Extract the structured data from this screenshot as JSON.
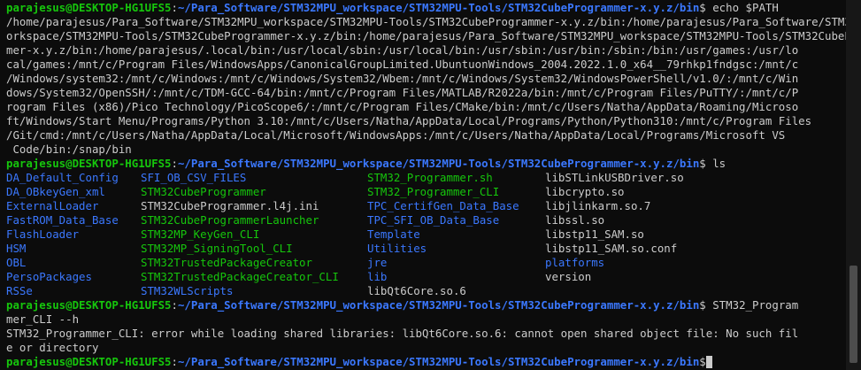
{
  "prompt": {
    "user_host": "parajesus@DESKTOP-HG1UFS5",
    "sep": ":",
    "cwd": "~/Para_Software/STM32MPU_workspace/STM32MPU-Tools/STM32CubeProgrammer-x.y.z/bin",
    "sym": "$"
  },
  "commands": {
    "echo": " echo $PATH",
    "ls": " ls",
    "run_part1": " STM32_Program",
    "run_part2": "mer_CLI --h"
  },
  "path_output": [
    "/home/parajesus/Para_Software/STM32MPU_workspace/STM32MPU-Tools/STM32CubeProgrammer-x.y.z/bin:/home/parajesus/Para_Software/STM32MPU_w",
    "orkspace/STM32MPU-Tools/STM32CubeProgrammer-x.y.z/bin:/home/parajesus/Para_Software/STM32MPU_workspace/STM32MPU-Tools/STM32CubeProgram",
    "mer-x.y.z/bin:/home/parajesus/.local/bin:/usr/local/sbin:/usr/local/bin:/usr/sbin:/usr/bin:/sbin:/bin:/usr/games:/usr/lo",
    "cal/games:/mnt/c/Program Files/WindowsApps/CanonicalGroupLimited.UbuntuonWindows_2004.2022.1.0_x64__79rhkp1fndgsc:/mnt/c",
    "/Windows/system32:/mnt/c/Windows:/mnt/c/Windows/System32/Wbem:/mnt/c/Windows/System32/WindowsPowerShell/v1.0/:/mnt/c/Win",
    "dows/System32/OpenSSH/:/mnt/c/TDM-GCC-64/bin:/mnt/c/Program Files/MATLAB/R2022a/bin:/mnt/c/Program Files/PuTTY/:/mnt/c/P",
    "rogram Files (x86)/Pico Technology/PicoScope6/:/mnt/c/Program Files/CMake/bin:/mnt/c/Users/Natha/AppData/Roaming/Microso",
    "ft/Windows/Start Menu/Programs/Python 3.10:/mnt/c/Users/Natha/AppData/Local/Programs/Python/Python310:/mnt/c/Program Files",
    "/Git/cmd:/mnt/c/Users/Natha/AppData/Local/Microsoft/WindowsApps:/mnt/c/Users/Natha/AppData/Local/Programs/Microsoft VS",
    " Code/bin:/snap/bin"
  ],
  "ls_rows": [
    [
      {
        "t": "DA_Default_Config",
        "k": "dir"
      },
      {
        "t": "SFI_OB_CSV_FILES",
        "k": "dir"
      },
      {
        "t": "STM32_Programmer.sh",
        "k": "exe"
      },
      {
        "t": "libSTLinkUSBDriver.so",
        "k": "plain"
      }
    ],
    [
      {
        "t": "DA_OBkeyGen_xml",
        "k": "dir"
      },
      {
        "t": "STM32CubeProgrammer",
        "k": "exe"
      },
      {
        "t": "STM32_Programmer_CLI",
        "k": "exe"
      },
      {
        "t": "libcrypto.so",
        "k": "plain"
      }
    ],
    [
      {
        "t": "ExternalLoader",
        "k": "dir"
      },
      {
        "t": "STM32CubeProgrammer.l4j.ini",
        "k": "plain"
      },
      {
        "t": "TPC_CertifGen_Data_Base",
        "k": "dir"
      },
      {
        "t": "libjlinkarm.so.7",
        "k": "plain"
      }
    ],
    [
      {
        "t": "FastROM_Data_Base",
        "k": "dir"
      },
      {
        "t": "STM32CubeProgrammerLauncher",
        "k": "exe"
      },
      {
        "t": "TPC_SFI_OB_Data_Base",
        "k": "dir"
      },
      {
        "t": "libssl.so",
        "k": "plain"
      }
    ],
    [
      {
        "t": "FlashLoader",
        "k": "dir"
      },
      {
        "t": "STM32MP_KeyGen_CLI",
        "k": "exe"
      },
      {
        "t": "Template",
        "k": "dir"
      },
      {
        "t": "libstp11_SAM.so",
        "k": "plain"
      }
    ],
    [
      {
        "t": "HSM",
        "k": "dir"
      },
      {
        "t": "STM32MP_SigningTool_CLI",
        "k": "exe"
      },
      {
        "t": "Utilities",
        "k": "dir"
      },
      {
        "t": "libstp11_SAM.so.conf",
        "k": "plain"
      }
    ],
    [
      {
        "t": "OBL",
        "k": "dir"
      },
      {
        "t": "STM32TrustedPackageCreator",
        "k": "exe"
      },
      {
        "t": "jre",
        "k": "dir"
      },
      {
        "t": "platforms",
        "k": "dir"
      }
    ],
    [
      {
        "t": "PersoPackages",
        "k": "dir"
      },
      {
        "t": "STM32TrustedPackageCreator_CLI",
        "k": "exe"
      },
      {
        "t": "lib",
        "k": "dir"
      },
      {
        "t": "version",
        "k": "plain"
      }
    ],
    [
      {
        "t": "RSSe",
        "k": "dir"
      },
      {
        "t": "STM32WLScripts",
        "k": "dir"
      },
      {
        "t": "libQt6Core.so.6",
        "k": "plain"
      },
      {
        "t": "",
        "k": "plain"
      }
    ]
  ],
  "error_output": [
    "STM32_Programmer_CLI: error while loading shared libraries: libQt6Core.so.6: cannot open shared object file: No such fil",
    "e or directory"
  ],
  "colors": {
    "background": "#0c0c0c",
    "foreground": "#cccccc",
    "green": "#16c60c",
    "blue": "#3b78ff"
  }
}
